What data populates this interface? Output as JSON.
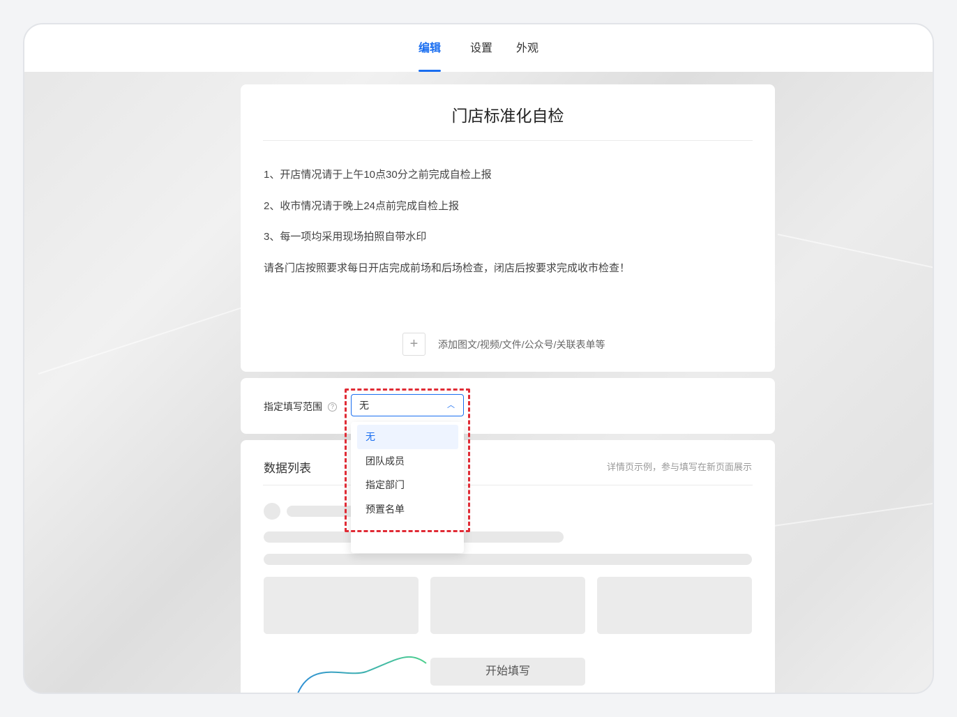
{
  "tabs": [
    {
      "label": "编辑",
      "active": true
    },
    {
      "label": "设置",
      "active": false
    },
    {
      "label": "外观",
      "active": false
    }
  ],
  "form": {
    "title": "门店标准化自检",
    "description": [
      "1、开店情况请于上午10点30分之前完成自检上报",
      "2、收市情况请于晚上24点前完成自检上报",
      "3、每一项均采用现场拍照自带水印",
      "请各门店按照要求每日开店完成前场和后场检查，闭店后按要求完成收市检查！"
    ],
    "add_content": "添加图文/视频/文件/公众号/关联表单等"
  },
  "range": {
    "label": "指定填写范围",
    "selected": "无",
    "options": [
      "无",
      "团队成员",
      "指定部门",
      "预置名单"
    ]
  },
  "data_list": {
    "title": "数据列表",
    "note": "详情页示例，参与填写在新页面展示",
    "start_button": "开始填写"
  },
  "colors": {
    "accent": "#1a6ef0",
    "highlight": "#e02b35"
  }
}
